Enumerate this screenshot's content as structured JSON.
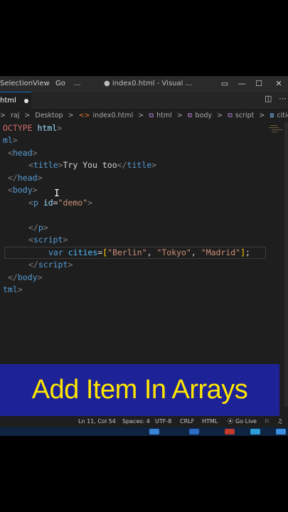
{
  "menu": {
    "selection": "Selection",
    "view": "View",
    "go": "Go",
    "more": "...",
    "window_title": "● index0.html - Visual ..."
  },
  "window_controls": {
    "layout": "▭",
    "minimize": "—",
    "maximize": "☐",
    "close": "✕"
  },
  "tab": {
    "label": "html",
    "modified": true
  },
  "breadcrumb": {
    "items": [
      ">",
      "raj",
      ">",
      "Desktop",
      ">",
      "index0.html",
      ">",
      "html",
      ">",
      "body",
      ">",
      "script",
      ">",
      "cities"
    ]
  },
  "code": {
    "l1": [
      "OCTYPE ",
      "html",
      ">"
    ],
    "l2": [
      "ml",
      ">"
    ],
    "l3": [
      "<",
      "head",
      ">"
    ],
    "l4": [
      "<",
      "title",
      ">",
      "Try You too",
      "</",
      "title",
      ">"
    ],
    "l5": [
      "</",
      "head",
      ">"
    ],
    "l6": [
      "<",
      "body",
      ">"
    ],
    "l7": [
      "<",
      "p",
      " ",
      "id",
      "=",
      "\"demo\"",
      ">"
    ],
    "l8": [
      "</",
      "p",
      ">"
    ],
    "l9": [
      "<",
      "script",
      ">"
    ],
    "l10": [
      "var",
      " ",
      "cities",
      "=",
      "[",
      "\"Berlin\"",
      ", ",
      "\"Tokyo\"",
      ", ",
      "\"Madrid\"",
      "]",
      ";"
    ],
    "l11": [
      "</",
      "script",
      ">"
    ],
    "l12": [
      "</",
      "body",
      ">"
    ],
    "l13": [
      "tml",
      ">"
    ]
  },
  "cursor_glyph": "I",
  "banner": {
    "text": "Add Item In Arrays",
    "bg": "#1d2296",
    "fg": "#ffe600"
  },
  "status": {
    "position": "Ln 11, Col 54",
    "spaces": "Spaces: 4",
    "encoding": "UTF-8",
    "eol": "CRLF",
    "language": "HTML",
    "golive": "Go Live"
  },
  "colors": {
    "editor_bg": "#1e1e1e",
    "tag": "#569cd6",
    "string": "#ce9178",
    "attr": "#9cdcfe"
  }
}
